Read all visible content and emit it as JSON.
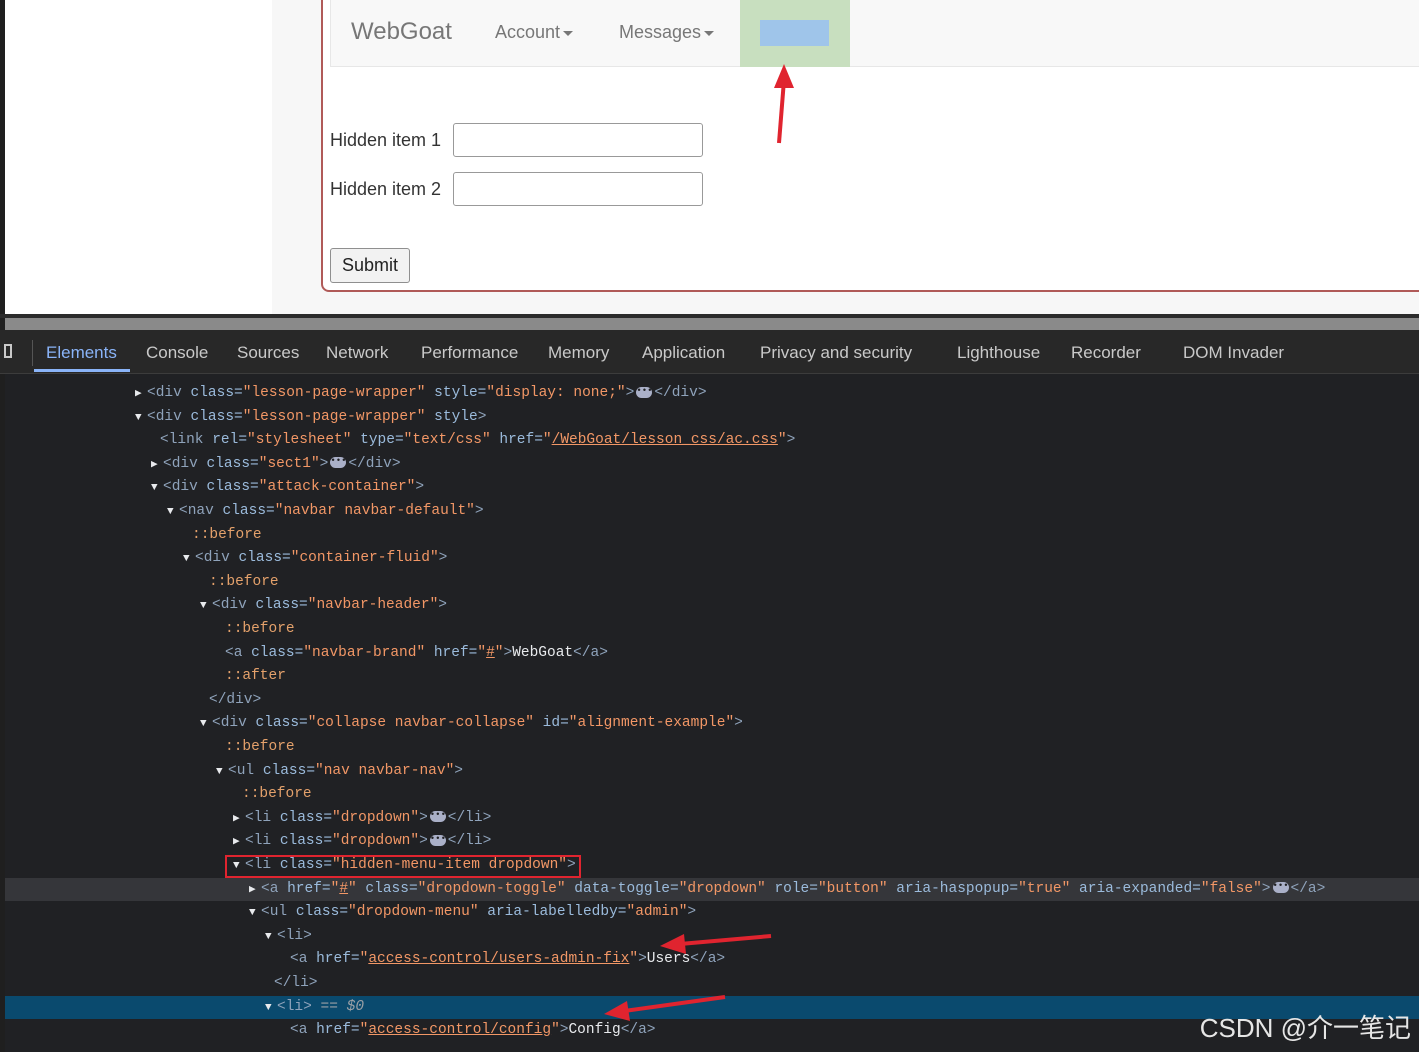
{
  "webpage": {
    "brand": "WebGoat",
    "nav_items": [
      {
        "label": "Account"
      },
      {
        "label": "Messages"
      }
    ],
    "form": {
      "hidden_item_1_label": "Hidden item 1",
      "hidden_item_1_value": "",
      "hidden_item_2_label": "Hidden item 2",
      "hidden_item_2_value": "",
      "submit_label": "Submit"
    }
  },
  "devtools": {
    "tabs": [
      "Elements",
      "Console",
      "Sources",
      "Network",
      "Performance",
      "Memory",
      "Application",
      "Privacy and security",
      "Lighthouse",
      "Recorder",
      "DOM Invader"
    ],
    "active_tab": "Elements",
    "dom": {
      "l1": {
        "cls": "lesson-page-wrapper",
        "style": "display: none;"
      },
      "l2": {
        "cls": "lesson-page-wrapper"
      },
      "l3": {
        "rel": "stylesheet",
        "type": "text/css",
        "href": "/WebGoat/lesson_css/ac.css"
      },
      "l4": {
        "cls": "sect1"
      },
      "l5": {
        "cls": "attack-container"
      },
      "l6": {
        "cls": "navbar navbar-default"
      },
      "before": "::before",
      "after": "::after",
      "l8": {
        "cls": "container-fluid"
      },
      "l10": {
        "cls": "navbar-header"
      },
      "l12": {
        "cls": "navbar-brand",
        "href": "#",
        "text": "WebGoat"
      },
      "l15": {
        "cls": "collapse navbar-collapse",
        "id": "alignment-example"
      },
      "l17": {
        "cls": "nav navbar-nav"
      },
      "l19": {
        "cls": "dropdown"
      },
      "l20": {
        "cls": "dropdown"
      },
      "l21": {
        "cls": "hidden-menu-item dropdown"
      },
      "l22": {
        "href": "#",
        "cls": "dropdown-toggle",
        "toggle": "dropdown",
        "role": "button",
        "haspopup": "true",
        "expanded": "false"
      },
      "l23": {
        "cls": "dropdown-menu",
        "labelledby": "admin"
      },
      "l25": {
        "href": "access-control/users-admin-fix",
        "text": "Users"
      },
      "l27_marker": "== $0",
      "l28": {
        "href": "access-control/config",
        "text": "Config"
      }
    }
  },
  "watermark": "CSDN @介一笔记",
  "colors": {
    "annotation_red": "#e0242f",
    "selected_row": "#0a4a6e",
    "hidden_item_highlight": "#c8dfbf"
  }
}
